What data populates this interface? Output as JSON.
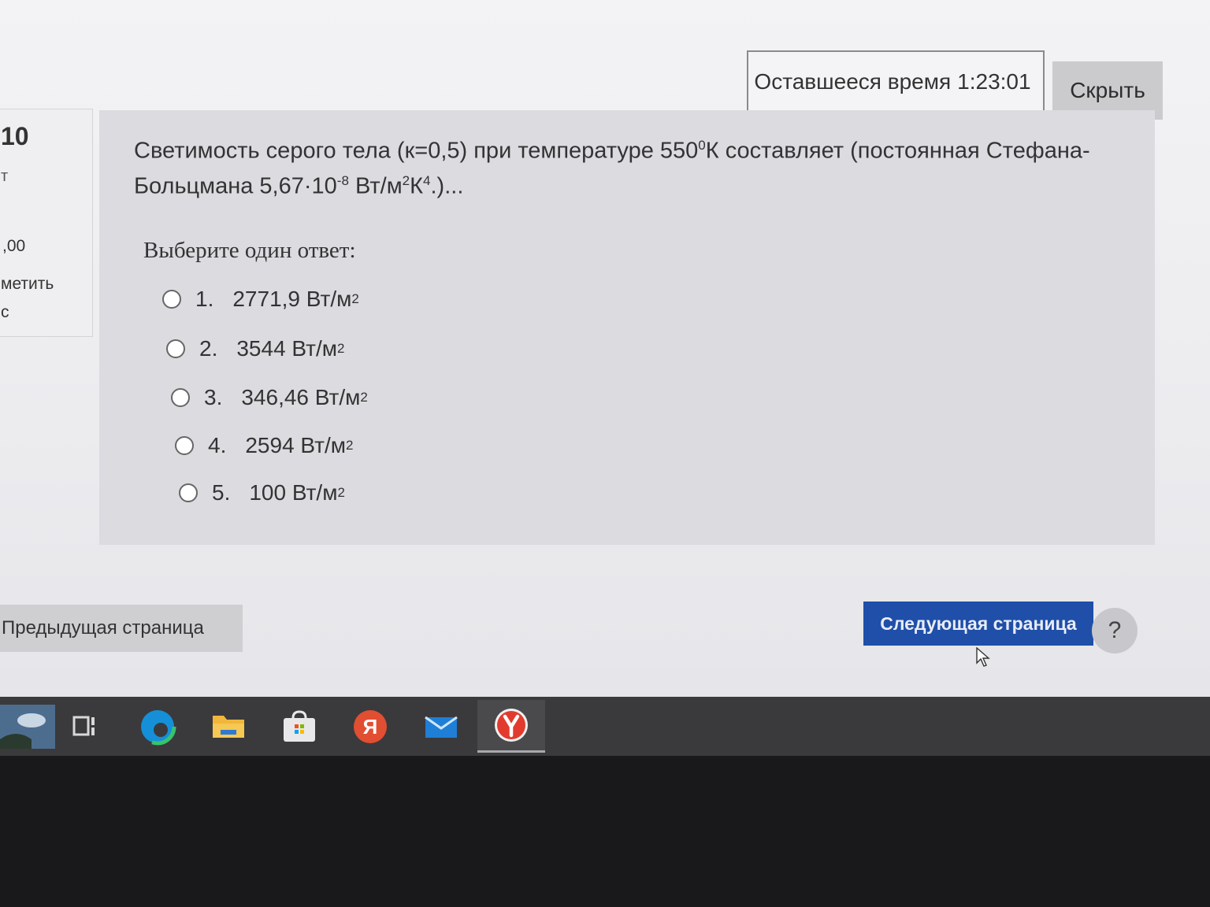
{
  "timer": {
    "label": "Оставшееся время",
    "value": "1:23:01"
  },
  "hide_button": "Скрыть",
  "info": {
    "question_number": "10",
    "status": "т",
    "grade": ",00",
    "flag_line1": "метить",
    "flag_line2": "с"
  },
  "question": {
    "line1_a": "Светимость серого тела (к=0,5) при температуре 550",
    "line1_sup": "0",
    "line1_b": "К составляет (постоянная Стефана-",
    "line2_a": "Больцмана 5,67·10",
    "line2_exp": "-8",
    "line2_b": " Вт/м",
    "line2_sup1": "2",
    "line2_c": "К",
    "line2_sup2": "4",
    "line2_d": ".)..."
  },
  "prompt": "Выберите один ответ:",
  "unit_sup": "2",
  "options": [
    {
      "num": "1.",
      "text": "2771,9 Вт/м"
    },
    {
      "num": "2.",
      "text": "3544 Вт/м"
    },
    {
      "num": "3.",
      "text": "346,46 Вт/м"
    },
    {
      "num": "4.",
      "text": "2594 Вт/м"
    },
    {
      "num": "5.",
      "text": "100 Вт/м"
    }
  ],
  "nav": {
    "prev": "Предыдущая страница",
    "next": "Следующая страница",
    "help": "?"
  },
  "taskbar_icons": [
    "weather-icon",
    "task-view-icon",
    "edge-icon",
    "file-explorer-icon",
    "store-icon",
    "yandex-icon",
    "mail-icon",
    "yandex-browser-icon"
  ]
}
